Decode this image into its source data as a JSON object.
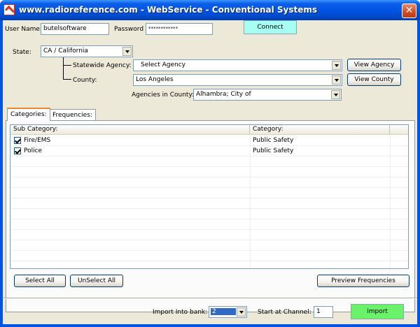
{
  "window": {
    "title": "www.radioreference.com - WebService - Conventional Systems",
    "close_glyph": "✕"
  },
  "login": {
    "user_label": "User Name:",
    "user_value": "butelsoftware",
    "password_label": "Password",
    "password_value": "************",
    "connect_label": "Connect"
  },
  "filters": {
    "state_label": "State:",
    "state_value": "CA / California",
    "statewide_label": "Statewide Agency:",
    "statewide_value": "Select Agency",
    "view_agency_label": "View Agency",
    "county_label": "County:",
    "county_value": "Los Angeles",
    "view_county_label": "View County",
    "agencies_label": "Agencies in County:",
    "agencies_value": "Alhambra; City of"
  },
  "tabs": [
    {
      "label": "Categories:",
      "active": true
    },
    {
      "label": "Frequencies:",
      "active": false
    }
  ],
  "table": {
    "columns": [
      "Sub Category:",
      "Category:"
    ],
    "rows": [
      {
        "checked": true,
        "sub_category": "Fire/EMS",
        "category": "Public Safety"
      },
      {
        "checked": true,
        "sub_category": "Police",
        "category": "Public Safety"
      }
    ]
  },
  "actions": {
    "select_all": "Select All",
    "unselect_all": "UnSelect All",
    "preview": "Preview Frequencies"
  },
  "footer": {
    "bank_label": "Import Into bank:",
    "bank_value": "2",
    "channel_label": "Start at Channel:",
    "channel_value": "1",
    "import_label": "Import"
  },
  "colors": {
    "titlebar": "#0054e3",
    "connect_button": "#a6fff2",
    "import_button": "#6bf26b",
    "active_tab_accent": "#e68b2c"
  }
}
